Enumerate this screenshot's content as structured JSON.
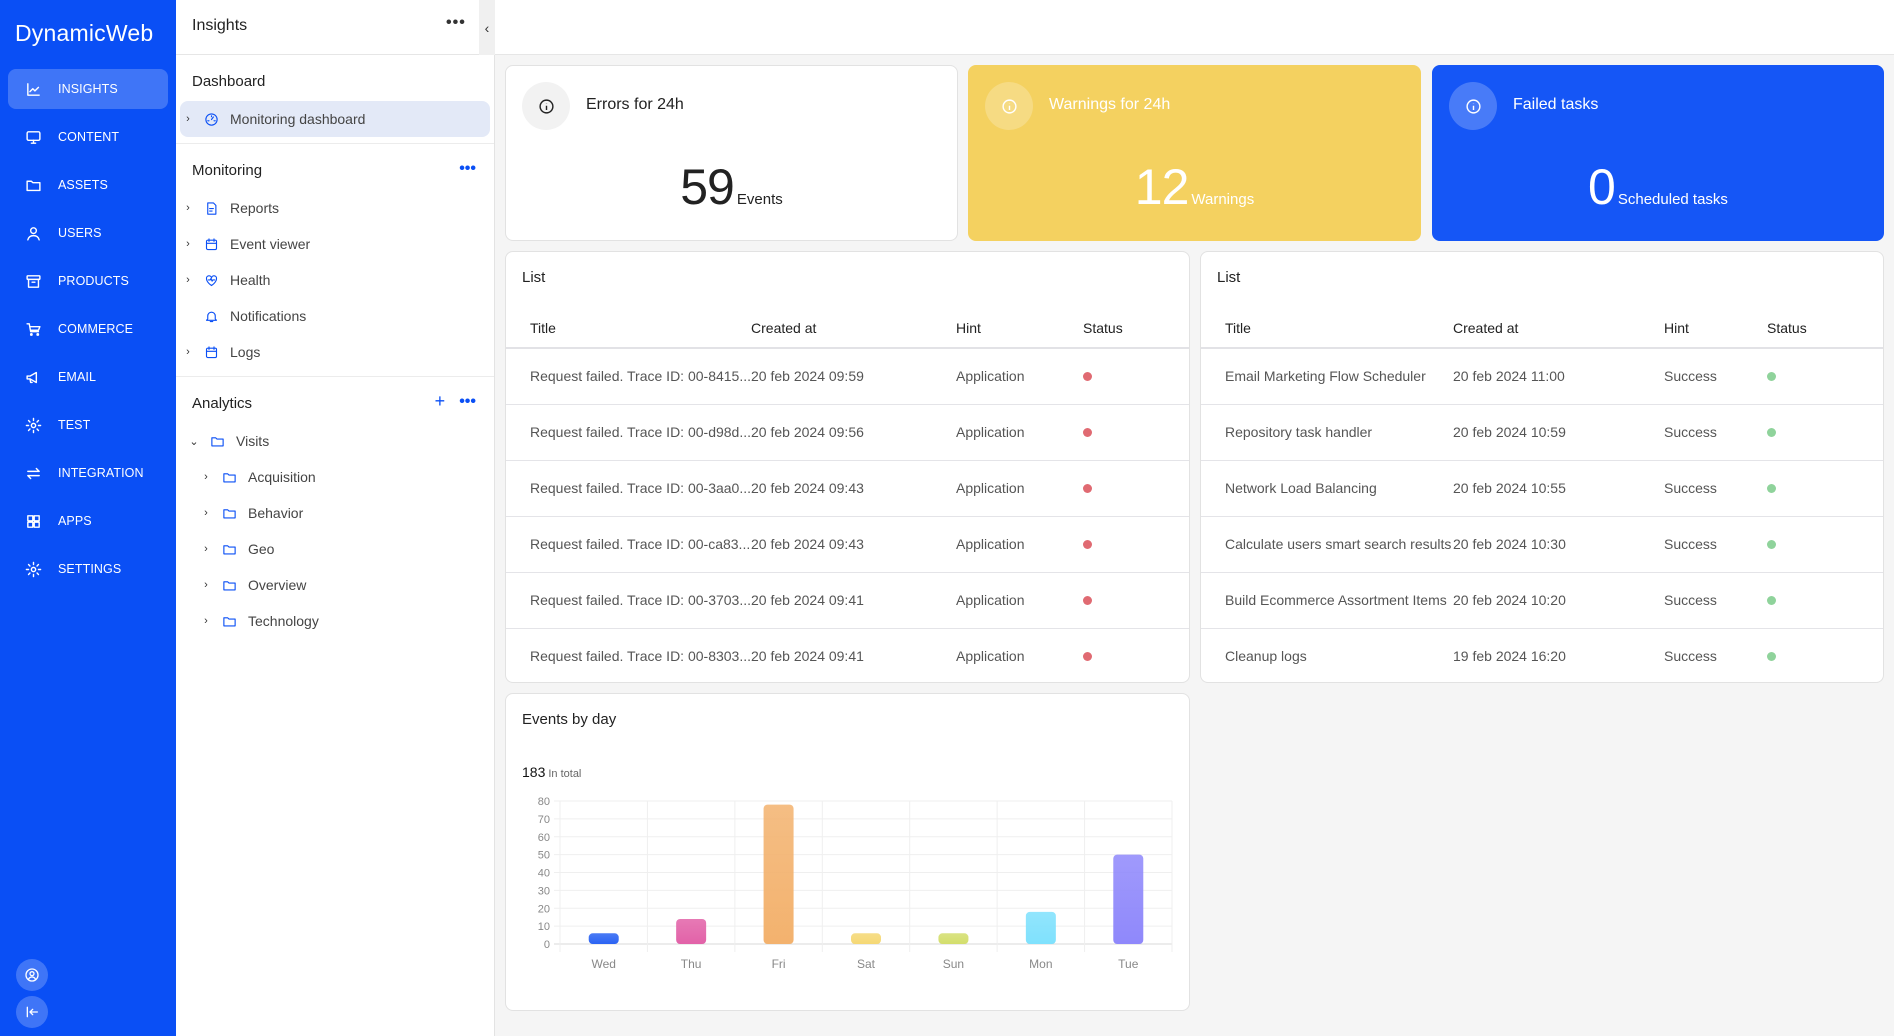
{
  "nav": {
    "brand": "DynamicWeb",
    "items": [
      {
        "label": "INSIGHTS",
        "icon": "chart-line-icon",
        "active": true
      },
      {
        "label": "CONTENT",
        "icon": "monitor-icon",
        "active": false
      },
      {
        "label": "ASSETS",
        "icon": "folder-icon",
        "active": false
      },
      {
        "label": "USERS",
        "icon": "user-icon",
        "active": false
      },
      {
        "label": "PRODUCTS",
        "icon": "archive-box-icon",
        "active": false
      },
      {
        "label": "COMMERCE",
        "icon": "cart-icon",
        "active": false
      },
      {
        "label": "EMAIL",
        "icon": "megaphone-icon",
        "active": false
      },
      {
        "label": "TEST",
        "icon": "gear-icon",
        "active": false
      },
      {
        "label": "INTEGRATION",
        "icon": "arrows-exchange-icon",
        "active": false
      },
      {
        "label": "APPS",
        "icon": "grid-icon",
        "active": false
      },
      {
        "label": "SETTINGS",
        "icon": "gear-icon",
        "active": false
      }
    ],
    "bottom": [
      {
        "icon": "user-circle-icon"
      },
      {
        "icon": "collapse-left-icon"
      }
    ]
  },
  "tree": {
    "title": "Insights",
    "more": "•••",
    "collapse": "‹",
    "sections": {
      "dashboard": {
        "title": "Dashboard",
        "items": [
          {
            "label": "Monitoring dashboard",
            "icon": "gauge-icon",
            "expandable": true,
            "selected": true
          }
        ]
      },
      "monitoring": {
        "title": "Monitoring",
        "more": "•••",
        "items": [
          {
            "label": "Reports",
            "icon": "report-icon",
            "expandable": true
          },
          {
            "label": "Event viewer",
            "icon": "calendar-icon",
            "expandable": true
          },
          {
            "label": "Health",
            "icon": "heart-pulse-icon",
            "expandable": true
          },
          {
            "label": "Notifications",
            "icon": "bell-icon",
            "expandable": false
          },
          {
            "label": "Logs",
            "icon": "calendar-icon",
            "expandable": true
          }
        ]
      },
      "analytics": {
        "title": "Analytics",
        "add": "+",
        "more": "•••",
        "root": {
          "label": "Visits",
          "icon": "folder-icon",
          "expanded": true
        },
        "children": [
          {
            "label": "Acquisition",
            "icon": "folder-icon"
          },
          {
            "label": "Behavior",
            "icon": "folder-icon"
          },
          {
            "label": "Geo",
            "icon": "folder-icon"
          },
          {
            "label": "Overview",
            "icon": "folder-icon"
          },
          {
            "label": "Technology",
            "icon": "folder-icon"
          }
        ]
      }
    }
  },
  "stats": {
    "errors": {
      "title": "Errors for 24h",
      "value": "59",
      "unit": "Events",
      "color": "#ffffff"
    },
    "warnings": {
      "title": "Warnings for 24h",
      "value": "12",
      "unit": "Warnings",
      "color": "#f4d160"
    },
    "failed": {
      "title": "Failed tasks",
      "value": "0",
      "unit": "Scheduled tasks",
      "color": "#1556f6"
    }
  },
  "lists": {
    "errors": {
      "title": "List",
      "columns": [
        "Title",
        "Created at",
        "Hint",
        "Status"
      ],
      "status_color": "#e06a72",
      "rows": [
        {
          "title": "Request failed. Trace ID: 00-8415...",
          "created": "20 feb 2024 09:59",
          "hint": "Application",
          "status": "error"
        },
        {
          "title": "Request failed. Trace ID: 00-d98d...",
          "created": "20 feb 2024 09:56",
          "hint": "Application",
          "status": "error"
        },
        {
          "title": "Request failed. Trace ID: 00-3aa0...",
          "created": "20 feb 2024 09:43",
          "hint": "Application",
          "status": "error"
        },
        {
          "title": "Request failed. Trace ID: 00-ca83...",
          "created": "20 feb 2024 09:43",
          "hint": "Application",
          "status": "error"
        },
        {
          "title": "Request failed. Trace ID: 00-3703...",
          "created": "20 feb 2024 09:41",
          "hint": "Application",
          "status": "error"
        },
        {
          "title": "Request failed. Trace ID: 00-8303...",
          "created": "20 feb 2024 09:41",
          "hint": "Application",
          "status": "error"
        }
      ]
    },
    "tasks": {
      "title": "List",
      "columns": [
        "Title",
        "Created at",
        "Hint",
        "Status"
      ],
      "status_color": "#8fd39b",
      "rows": [
        {
          "title": "Email Marketing Flow Scheduler",
          "created": "20 feb 2024 11:00",
          "hint": "Success",
          "status": "success"
        },
        {
          "title": "Repository task handler",
          "created": "20 feb 2024 10:59",
          "hint": "Success",
          "status": "success"
        },
        {
          "title": "Network Load Balancing",
          "created": "20 feb 2024 10:55",
          "hint": "Success",
          "status": "success"
        },
        {
          "title": "Calculate users smart search results",
          "created": "20 feb 2024 10:30",
          "hint": "Success",
          "status": "success"
        },
        {
          "title": "Build Ecommerce Assortment Items",
          "created": "20 feb 2024 10:20",
          "hint": "Success",
          "status": "success"
        },
        {
          "title": "Cleanup logs",
          "created": "19 feb 2024 16:20",
          "hint": "Success",
          "status": "success"
        }
      ]
    }
  },
  "events_card": {
    "title": "Events by day",
    "total": "183",
    "total_label": "In total"
  },
  "chart_data": {
    "type": "bar",
    "title": "Events by day",
    "categories": [
      "Wed",
      "Thu",
      "Fri",
      "Sat",
      "Sun",
      "Mon",
      "Tue"
    ],
    "values": [
      6,
      14,
      78,
      6,
      6,
      18,
      50
    ],
    "colors": [
      "#2a63f3",
      "#e262a8",
      "#f3b26e",
      "#f5d874",
      "#d3de6c",
      "#7fe1fd",
      "#8f88fb"
    ],
    "xlabel": "",
    "ylabel": "",
    "ylim": [
      0,
      80
    ],
    "yticks": [
      0,
      10,
      20,
      30,
      40,
      50,
      60,
      70,
      80
    ],
    "grid": true,
    "legend": "none"
  }
}
